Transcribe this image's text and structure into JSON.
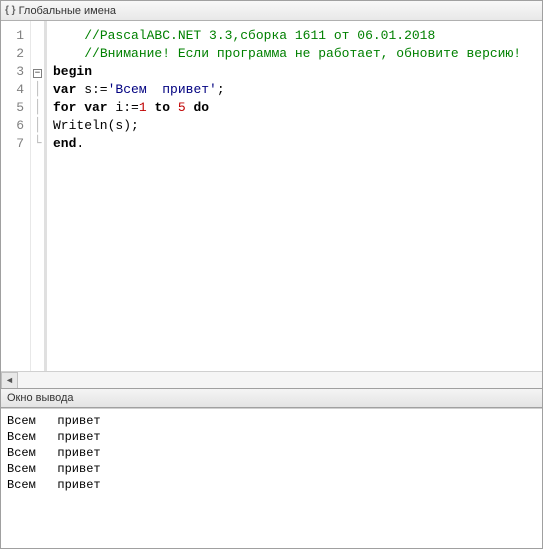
{
  "tabbar": {
    "title": "Глобальные имена"
  },
  "gutter": [
    "1",
    "2",
    "3",
    "4",
    "5",
    "6",
    "7"
  ],
  "fold": [
    "",
    "",
    "−",
    "",
    "",
    "",
    ""
  ],
  "code": {
    "l1": {
      "indent": "    ",
      "text": "//PascalABC.NET 3.3,сборка 1611 от 06.01.2018"
    },
    "l2": {
      "indent": "    ",
      "text": "//Внимание! Если программа не работает, обновите версию!"
    },
    "l3": {
      "kw": "begin"
    },
    "l4": {
      "kw1": "var",
      "mid1": " s:=",
      "str": "'Всем  привет'",
      "mid2": ";"
    },
    "l5": {
      "kw1": "for var",
      "mid1": " i:=",
      "num1": "1",
      "kw2": " to ",
      "num2": "5",
      "kw3": " do"
    },
    "l6": {
      "text": "Writeln(s);"
    },
    "l7": {
      "kw": "end",
      "tail": "."
    }
  },
  "output_title": "Окно вывода",
  "output_lines": [
    "Всем   привет",
    "Всем   привет",
    "Всем   привет",
    "Всем   привет",
    "Всем   привет"
  ]
}
